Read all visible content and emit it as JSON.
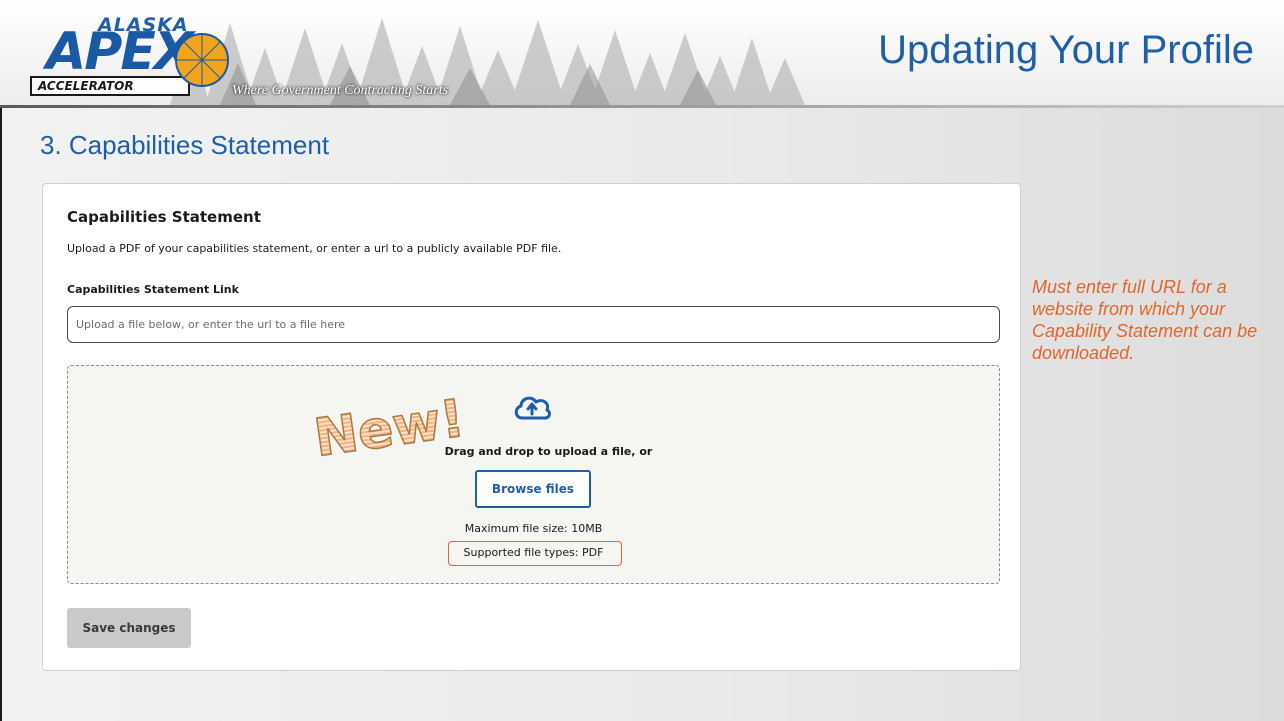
{
  "header": {
    "logo": {
      "top_word": "ALASKA",
      "main_word": "APEX",
      "bottom_word": "ACCELERATOR"
    },
    "tagline": "Where Government Contracting Starts",
    "slide_title": "Updating Your Profile"
  },
  "section_title": "3.  Capabilities Statement",
  "panel": {
    "heading": "Capabilities Statement",
    "description": "Upload a PDF of your capabilities statement, or enter a url to a publicly available PDF file.",
    "link_label": "Capabilities Statement Link",
    "link_value": "",
    "link_placeholder": "Upload a file below, or enter the url to a file here",
    "dropzone": {
      "badge": "New!",
      "drag_text": "Drag and drop to upload a file, or",
      "browse_label": "Browse files",
      "max_size": "Maximum file size: 10MB",
      "supported_types": "Supported file types: PDF"
    },
    "save_label": "Save changes"
  },
  "side_note": "Must enter full URL for a website from which your Capability Statement can be downloaded.",
  "colors": {
    "brand_blue": "#1f5fa8",
    "accent_orange": "#e0662c",
    "disabled_gray": "#c9c9c9"
  }
}
